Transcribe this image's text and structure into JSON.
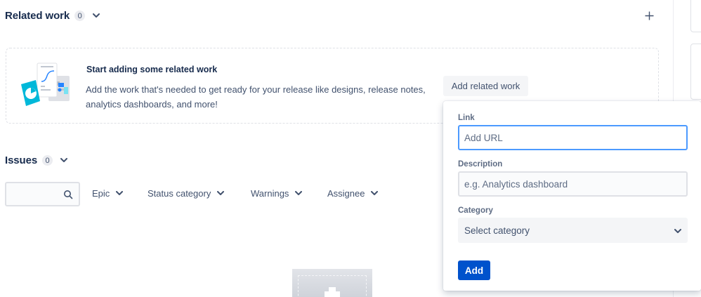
{
  "related_work": {
    "title": "Related work",
    "count": "0",
    "empty_state": {
      "title": "Start adding some related work",
      "description": "Add the work that's needed to get ready for your release like designs, release notes, analytics dashboards, and more!",
      "add_button_label": "Add related work"
    }
  },
  "issues": {
    "title": "Issues",
    "count": "0",
    "search": {
      "value": "",
      "placeholder": ""
    },
    "filters": [
      "Epic",
      "Status category",
      "Warnings",
      "Assignee"
    ]
  },
  "popup": {
    "link": {
      "label": "Link",
      "placeholder": "Add URL",
      "value": ""
    },
    "description": {
      "label": "Description",
      "placeholder": "e.g. Analytics dashboard",
      "value": ""
    },
    "category": {
      "label": "Category",
      "selected": "Select category"
    },
    "submit_label": "Add"
  },
  "colors": {
    "primary": "#0052cc",
    "focus_ring": "#4c9aff",
    "text_dark": "#172b4d",
    "text_muted": "#42526e",
    "subtle_bg": "#f4f5f7",
    "border": "#dfe1e6"
  },
  "icons": {
    "header_chevron": "chevron-down-icon",
    "add": "plus-icon",
    "search": "search-icon",
    "illustration": "documents-chart-illustration",
    "empty_placeholder": "add-placeholder-illustration"
  }
}
